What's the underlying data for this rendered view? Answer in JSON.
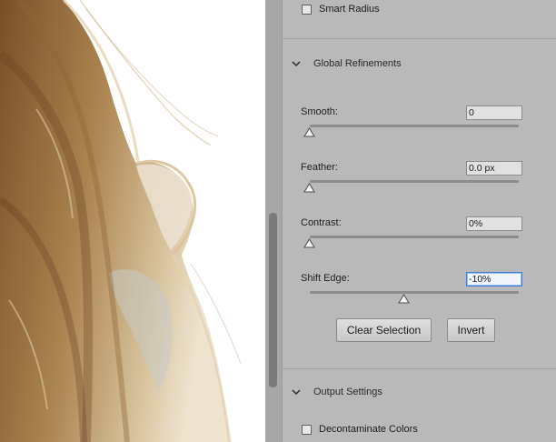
{
  "canvas": {
    "description_icon": "hair-photo"
  },
  "panel": {
    "smart_radius": {
      "label": "Smart Radius",
      "checked": false
    },
    "global_refinements": {
      "title": "Global Refinements",
      "expanded": true,
      "fields": [
        {
          "label": "Smooth:",
          "value": "0",
          "level": 0.0
        },
        {
          "label": "Feather:",
          "value": "0.0 px",
          "level": 0.0
        },
        {
          "label": "Contrast:",
          "value": "0%",
          "level": 0.0
        },
        {
          "label": "Shift Edge:",
          "value": "-10%",
          "level": 0.45
        }
      ],
      "clear_selection_label": "Clear Selection",
      "invert_label": "Invert"
    },
    "output_settings": {
      "title": "Output Settings",
      "expanded": true,
      "decontaminate": {
        "label": "Decontaminate Colors",
        "checked": false
      }
    }
  },
  "colors": {
    "panel_bg": "#b9b9b9",
    "active_field_border": "#3d7bd9",
    "hair_dark": "#8a6136",
    "hair_light": "#e7d7b8"
  }
}
